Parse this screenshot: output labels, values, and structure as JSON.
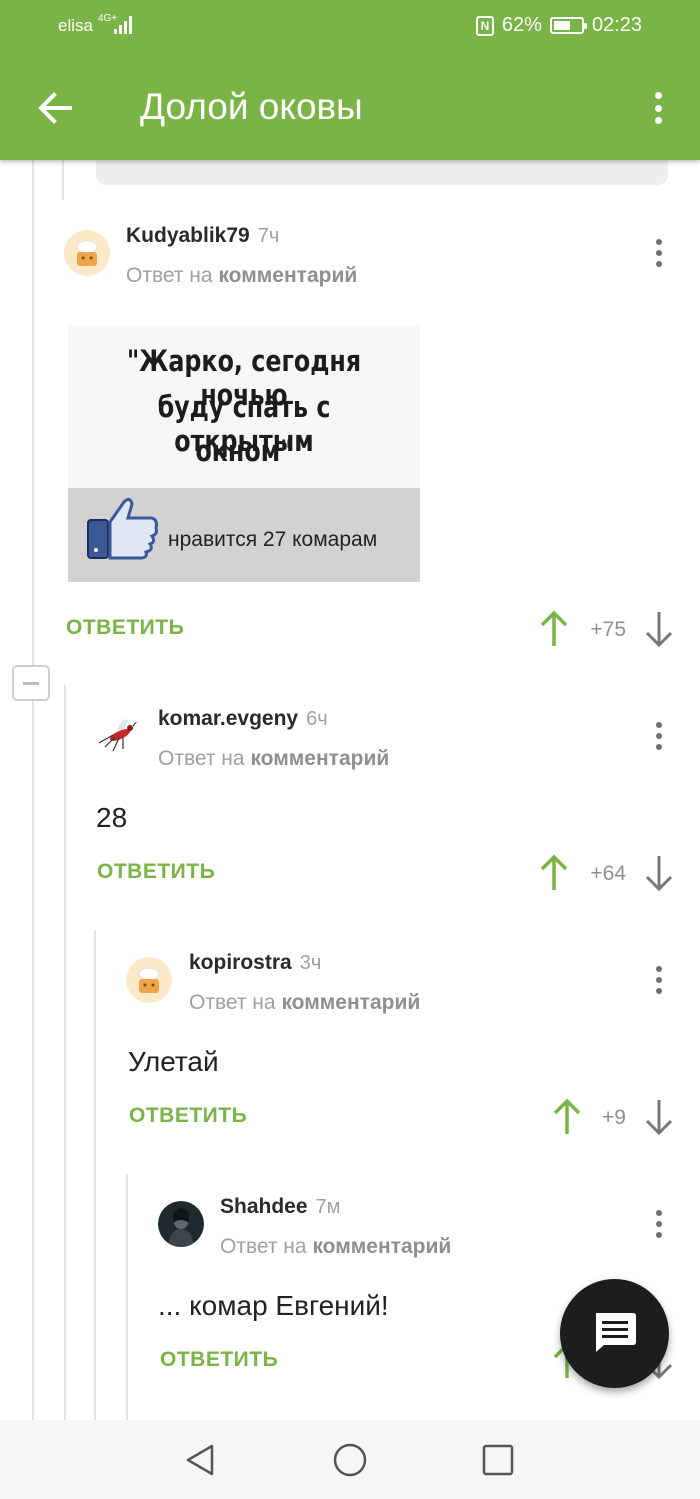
{
  "status_bar": {
    "carrier": "elisa",
    "network": "4G+",
    "battery": "62%",
    "battery_level": 0.62,
    "time": "02:23"
  },
  "header": {
    "title": "Долой оковы",
    "accent": "#7ab446"
  },
  "labels": {
    "reply_to_prefix": "Ответ на",
    "reply_to_target": "комментарий",
    "reply_button": "ОТВЕТИТЬ"
  },
  "comments": [
    {
      "author": "Kudyablik79",
      "time": "7ч",
      "score": "+75",
      "image_text": [
        "\"Жарко, сегодня ночью",
        "буду спать с открытым",
        "окном\""
      ],
      "image_caption": "нравится 27 комарам"
    },
    {
      "author": "komar.evgeny",
      "time": "6ч",
      "text": "28",
      "score": "+64"
    },
    {
      "author": "kopirostra",
      "time": "3ч",
      "text": "Улетай",
      "score": "+9"
    },
    {
      "author": "Shahdee",
      "time": "7м",
      "text": "... комар Евгений!"
    }
  ],
  "icons": [
    "back-arrow-icon",
    "more-vert-icon",
    "arrow-up-icon",
    "arrow-down-icon",
    "comment-icon",
    "nav-back-icon",
    "nav-home-icon",
    "nav-recents-icon",
    "nfc-icon",
    "battery-icon",
    "signal-icon"
  ]
}
